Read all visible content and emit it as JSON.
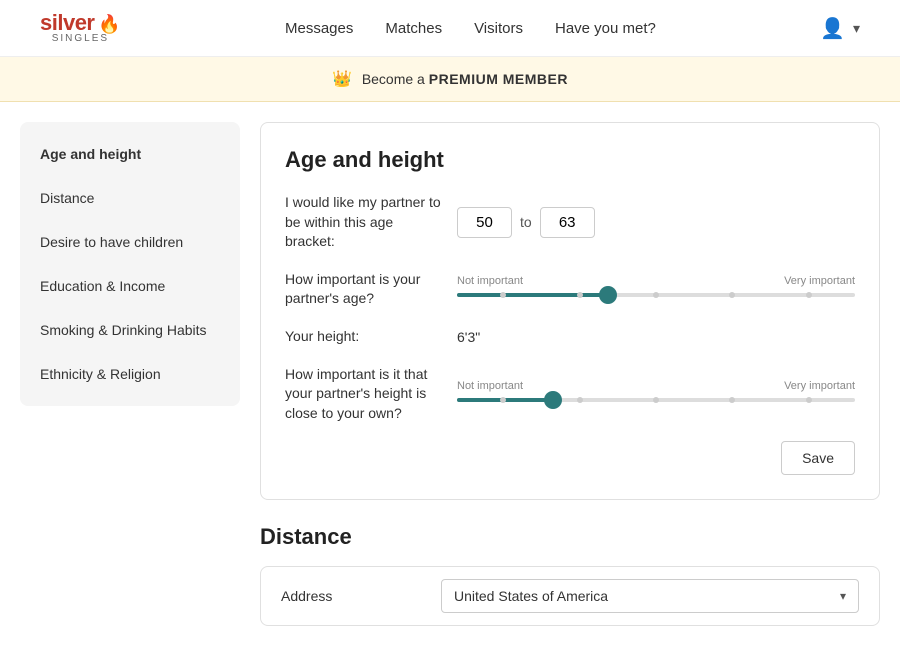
{
  "header": {
    "logo_silver": "silver",
    "logo_singles": "SINGLES",
    "nav_items": [
      {
        "label": "Messages",
        "id": "messages"
      },
      {
        "label": "Matches",
        "id": "matches"
      },
      {
        "label": "Visitors",
        "id": "visitors"
      },
      {
        "label": "Have you met?",
        "id": "have-you-met"
      }
    ]
  },
  "premium_banner": {
    "text_before": "Become a ",
    "text_bold": "PREMIUM MEMBER"
  },
  "sidebar": {
    "items": [
      {
        "label": "Age and height",
        "id": "age-height",
        "active": true
      },
      {
        "label": "Distance",
        "id": "distance",
        "active": false
      },
      {
        "label": "Desire to have children",
        "id": "children",
        "active": false
      },
      {
        "label": "Education & Income",
        "id": "education",
        "active": false
      },
      {
        "label": "Smoking & Drinking Habits",
        "id": "smoking",
        "active": false
      },
      {
        "label": "Ethnicity & Religion",
        "id": "ethnicity",
        "active": false
      }
    ]
  },
  "age_height_section": {
    "title": "Age and height",
    "age_bracket_label": "I would like my partner to be within this age bracket:",
    "age_min": "50",
    "age_max": "63",
    "age_to": "to",
    "importance_age_label": "How important is your partner's age?",
    "not_important": "Not important",
    "very_important": "Very important",
    "height_label": "Your height:",
    "height_value": "6'3\"",
    "importance_height_label": "How important is it that your partner's height is close to your own?",
    "save_label": "Save"
  },
  "distance_section": {
    "title": "Distance",
    "address_label": "Address",
    "address_value": "United States of America"
  }
}
